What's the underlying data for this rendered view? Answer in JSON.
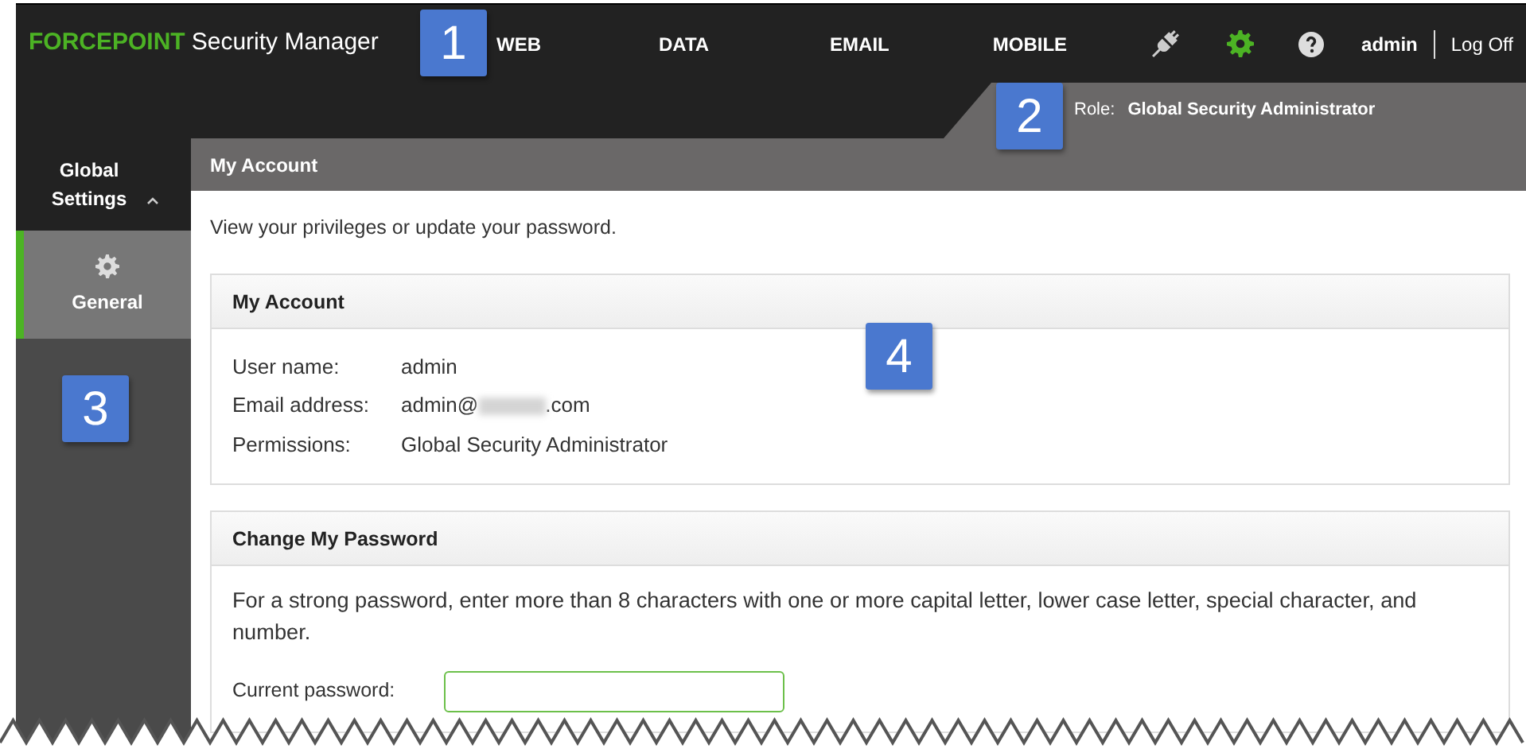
{
  "header": {
    "brand": "FORCEPOINT",
    "product": "Security Manager",
    "modules": [
      {
        "label": "WEB",
        "selected": false
      },
      {
        "label": "DATA",
        "selected": false
      },
      {
        "label": "EMAIL",
        "selected": false
      },
      {
        "label": "MOBILE",
        "selected": false
      }
    ],
    "user": "admin",
    "logoff": "Log Off"
  },
  "role": {
    "label": "Role:",
    "value": "Global Security Administrator"
  },
  "sidebar": {
    "section": "Global Settings",
    "expanded": true,
    "items": [
      {
        "label": "General",
        "selected": true
      }
    ]
  },
  "page_title": "My Account",
  "intro": "View your privileges or update your password.",
  "account_panel": {
    "title": "My Account",
    "fields": [
      {
        "label": "User name:",
        "value": "admin"
      },
      {
        "label": "Email address:",
        "value": "admin@",
        "redacted": true,
        "suffix": ".com"
      },
      {
        "label": "Permissions:",
        "value": "Global Security Administrator"
      }
    ]
  },
  "password_panel": {
    "title": "Change My Password",
    "hint": "For a strong password, enter more than 8 characters with one or more capital letter, lower case letter, special character, and number.",
    "fields": [
      {
        "label": "Current password:"
      }
    ]
  },
  "callouts": [
    "1",
    "2",
    "3",
    "4"
  ]
}
